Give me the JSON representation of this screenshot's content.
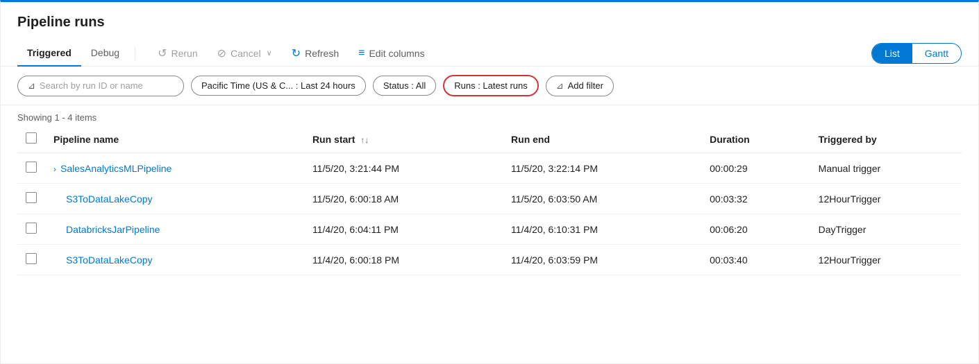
{
  "page": {
    "title": "Pipeline runs",
    "top_border_color": "#0078d4"
  },
  "toolbar": {
    "tabs": [
      {
        "id": "triggered",
        "label": "Triggered",
        "active": true
      },
      {
        "id": "debug",
        "label": "Debug",
        "active": false
      }
    ],
    "actions": [
      {
        "id": "rerun",
        "label": "Rerun",
        "icon": "↺",
        "disabled": true
      },
      {
        "id": "cancel",
        "label": "Cancel",
        "icon": "⊘",
        "has_dropdown": true,
        "disabled": true
      },
      {
        "id": "refresh",
        "label": "Refresh",
        "icon": "↻",
        "disabled": false
      },
      {
        "id": "edit-columns",
        "label": "Edit columns",
        "icon": "≡",
        "disabled": false
      }
    ],
    "view_toggle": {
      "options": [
        "List",
        "Gantt"
      ],
      "active": "List"
    }
  },
  "filters": {
    "search": {
      "placeholder": "Search by run ID or name"
    },
    "time": {
      "label": "Pacific Time (US & C... : Last 24 hours"
    },
    "status": {
      "label": "Status : All"
    },
    "runs": {
      "label": "Runs : Latest runs",
      "highlighted": true
    },
    "add_filter": {
      "label": "Add filter"
    }
  },
  "table": {
    "showing_text": "Showing 1 - 4 items",
    "columns": [
      {
        "id": "checkbox",
        "label": ""
      },
      {
        "id": "pipeline_name",
        "label": "Pipeline name"
      },
      {
        "id": "run_start",
        "label": "Run start",
        "sortable": true
      },
      {
        "id": "run_end",
        "label": "Run end"
      },
      {
        "id": "duration",
        "label": "Duration"
      },
      {
        "id": "triggered_by",
        "label": "Triggered by"
      }
    ],
    "rows": [
      {
        "id": "row1",
        "has_expand": true,
        "pipeline_name": "SalesAnalyticsMLPipeline",
        "run_start": "11/5/20, 3:21:44 PM",
        "run_end": "11/5/20, 3:22:14 PM",
        "duration": "00:00:29",
        "triggered_by": "Manual trigger"
      },
      {
        "id": "row2",
        "has_expand": false,
        "pipeline_name": "S3ToDataLakeCopy",
        "run_start": "11/5/20, 6:00:18 AM",
        "run_end": "11/5/20, 6:03:50 AM",
        "duration": "00:03:32",
        "triggered_by": "12HourTrigger"
      },
      {
        "id": "row3",
        "has_expand": false,
        "pipeline_name": "DatabricksJarPipeline",
        "run_start": "11/4/20, 6:04:11 PM",
        "run_end": "11/4/20, 6:10:31 PM",
        "duration": "00:06:20",
        "triggered_by": "DayTrigger"
      },
      {
        "id": "row4",
        "has_expand": false,
        "pipeline_name": "S3ToDataLakeCopy",
        "run_start": "11/4/20, 6:00:18 PM",
        "run_end": "11/4/20, 6:03:59 PM",
        "duration": "00:03:40",
        "triggered_by": "12HourTrigger"
      }
    ]
  },
  "icons": {
    "rerun": "↺",
    "cancel": "⊘",
    "refresh": "↻",
    "edit_columns": "≡",
    "filter": "⊿",
    "sort_updown": "↑↓",
    "expand": "›",
    "add_filter": "⊿",
    "chevron_down": "∨"
  }
}
